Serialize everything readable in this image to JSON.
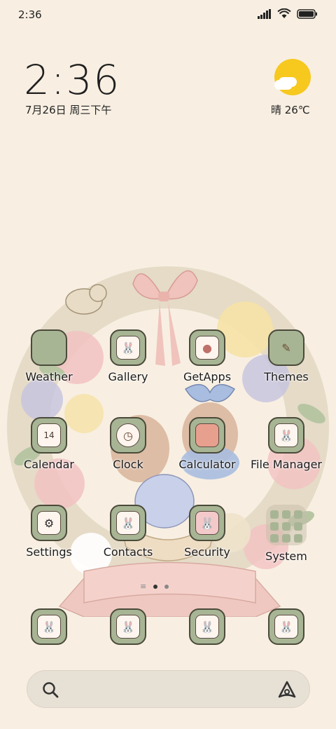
{
  "status_bar": {
    "time": "2:36",
    "icons": [
      "signal-icon",
      "wifi-icon",
      "battery-icon"
    ]
  },
  "clock_widget": {
    "time": "2:36",
    "date": "7月26日 周三下午"
  },
  "weather_widget": {
    "condition_icon": "sun-cloud-icon",
    "text": "晴 26℃"
  },
  "apps_grid": [
    {
      "label": "Weather",
      "icon": "weather-icon"
    },
    {
      "label": "Gallery",
      "icon": "gallery-icon"
    },
    {
      "label": "GetApps",
      "icon": "cupcake-icon"
    },
    {
      "label": "Themes",
      "icon": "brush-icon"
    },
    {
      "label": "Calendar",
      "icon": "calendar-icon",
      "badge": "14"
    },
    {
      "label": "Clock",
      "icon": "clock-icon"
    },
    {
      "label": "Calculator",
      "icon": "calculator-icon"
    },
    {
      "label": "File Manager",
      "icon": "bunny-folder-icon"
    },
    {
      "label": "Settings",
      "icon": "gear-bunny-icon"
    },
    {
      "label": "Contacts",
      "icon": "bunny-contacts-icon"
    },
    {
      "label": "Security",
      "icon": "bunny-security-icon"
    },
    {
      "label": "System",
      "icon": "folder-icon"
    }
  ],
  "page_indicator": {
    "pages": 2,
    "current": 1
  },
  "dock": [
    {
      "icon": "bunny-phone-icon"
    },
    {
      "icon": "bunny-messages-icon"
    },
    {
      "icon": "bunny-browser-icon"
    },
    {
      "icon": "bunny-camera-icon"
    }
  ],
  "search_bar": {
    "search_icon": "search-icon",
    "assistant_icon": "assistant-icon"
  },
  "colors": {
    "background": "#f8efe2",
    "icon_tile": "#a8b595",
    "ribbon": "#efc7c0",
    "sun": "#f7c81e"
  }
}
